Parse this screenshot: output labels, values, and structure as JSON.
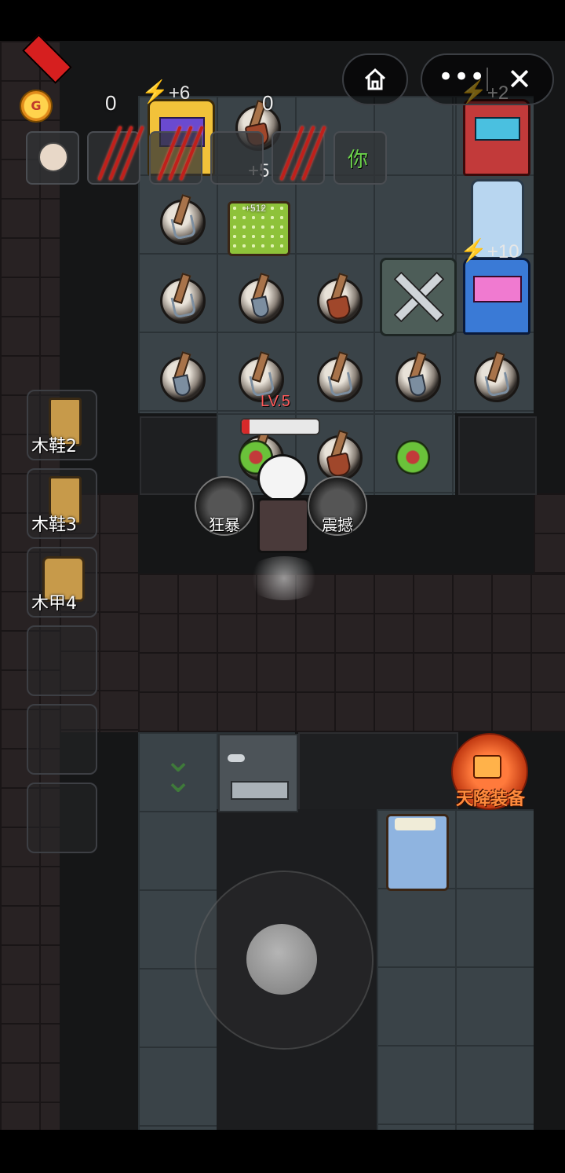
{
  "hud": {
    "coin_symbol": "G",
    "coins": "0",
    "count2": "0",
    "energy_left": "+6",
    "energy_right": "+2",
    "energy_mid": "+10",
    "bed_income": "+5",
    "bed_income_small": "+512",
    "ni_label": "你"
  },
  "miniapp": {
    "home_icon": "home-icon",
    "more_icon": "more-icon",
    "close_icon": "close-icon"
  },
  "player": {
    "level": "LV.5",
    "hp_fraction": 0.1
  },
  "skills": [
    {
      "label": "狂暴"
    },
    {
      "label": "震撼"
    }
  ],
  "equipment": [
    {
      "label": "木鞋2",
      "icon": "boot-icon"
    },
    {
      "label": "木鞋3",
      "icon": "boot-icon"
    },
    {
      "label": "木甲4",
      "icon": "armor-icon"
    },
    {
      "label": ""
    },
    {
      "label": ""
    },
    {
      "label": ""
    }
  ],
  "video_button": {
    "label": "天降装备"
  },
  "colors": {
    "accent_orange": "#ff8b3c",
    "hp_red": "#d62a2a",
    "energy_blue": "#49a9d9"
  }
}
